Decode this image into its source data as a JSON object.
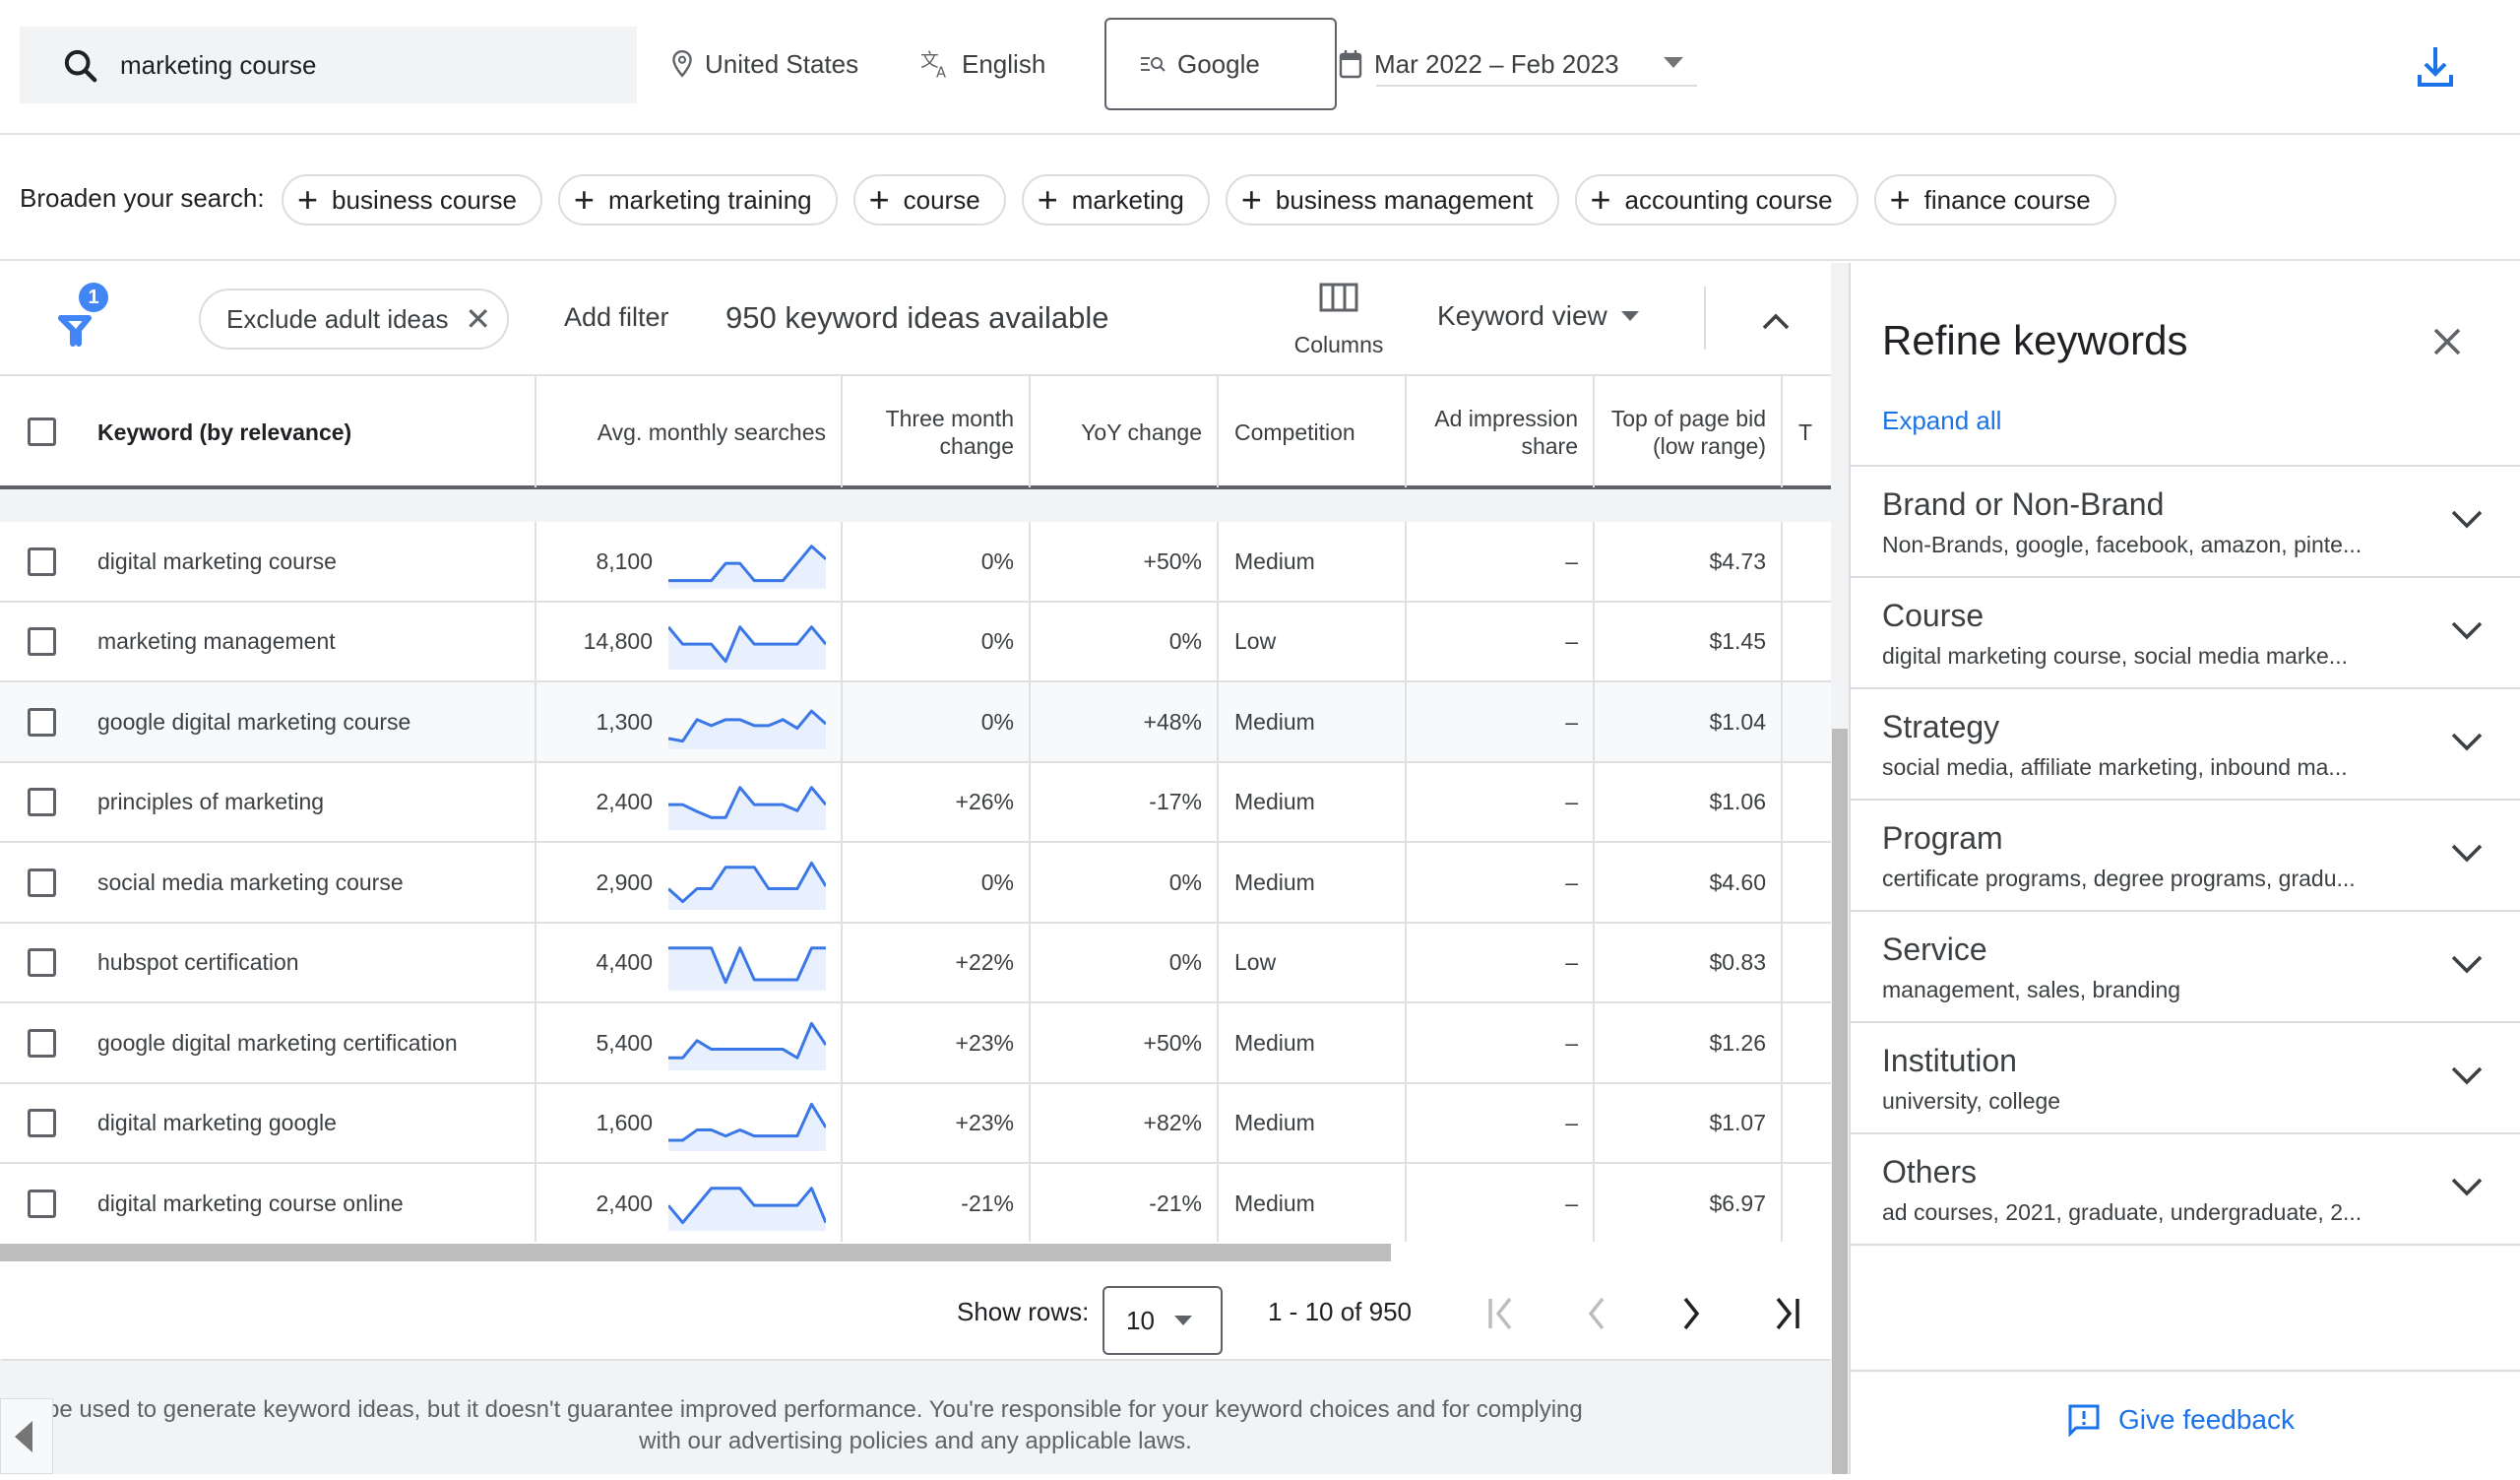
{
  "search": {
    "query": "marketing course",
    "location": "United States",
    "language": "English",
    "network": "Google",
    "date_range": "Mar 2022 – Feb 2023"
  },
  "broaden": {
    "label": "Broaden your search:",
    "chips": [
      "business course",
      "marketing training",
      "course",
      "marketing",
      "business management",
      "accounting course",
      "finance course"
    ]
  },
  "toolbar": {
    "filter_count": "1",
    "exclude_chip": "Exclude adult ideas",
    "add_filter": "Add filter",
    "ideas_count": "950 keyword ideas available",
    "columns_label": "Columns",
    "view_label": "Keyword view"
  },
  "table": {
    "headers": {
      "keyword": "Keyword (by relevance)",
      "avg": "Avg. monthly searches",
      "three_month": "Three month change",
      "yoy": "YoY change",
      "competition": "Competition",
      "ad_share": "Ad impression share",
      "top_low": "Top of page bid (low range)",
      "next": "T"
    },
    "rows": [
      {
        "keyword": "digital marketing course",
        "avg": "8,100",
        "trend": [
          1,
          1,
          1,
          1,
          3,
          3,
          1,
          1,
          1,
          3,
          5,
          3.5
        ],
        "three_month": "0%",
        "yoy": "+50%",
        "competition": "Medium",
        "ad_share": "–",
        "top_low": "$4.73"
      },
      {
        "keyword": "marketing management",
        "avg": "14,800",
        "trend": [
          5,
          3,
          3,
          3,
          1,
          5,
          3,
          3,
          3,
          3,
          5,
          3
        ],
        "three_month": "0%",
        "yoy": "0%",
        "competition": "Low",
        "ad_share": "–",
        "top_low": "$1.45"
      },
      {
        "keyword": "google digital marketing course",
        "avg": "1,300",
        "trend": [
          1.3,
          1,
          3.5,
          2.8,
          3.5,
          3.5,
          2.8,
          2.8,
          3.5,
          2.5,
          4.5,
          3
        ],
        "three_month": "0%",
        "yoy": "+48%",
        "competition": "Medium",
        "ad_share": "–",
        "top_low": "$1.04"
      },
      {
        "keyword": "principles of marketing",
        "avg": "2,400",
        "trend": [
          3,
          3,
          2.2,
          1.5,
          1.5,
          5,
          3,
          3,
          3,
          2.3,
          5,
          3
        ],
        "three_month": "+26%",
        "yoy": "-17%",
        "competition": "Medium",
        "ad_share": "–",
        "top_low": "$1.06"
      },
      {
        "keyword": "social media marketing course",
        "avg": "2,900",
        "trend": [
          2.5,
          1,
          2.5,
          2.5,
          5,
          5,
          5,
          2.5,
          2.5,
          2.5,
          5.5,
          2.8
        ],
        "three_month": "0%",
        "yoy": "0%",
        "competition": "Medium",
        "ad_share": "–",
        "top_low": "$4.60"
      },
      {
        "keyword": "hubspot certification",
        "avg": "4,400",
        "trend": [
          5,
          5,
          5,
          5,
          1,
          5,
          1.3,
          1.3,
          1.3,
          1.3,
          5,
          5
        ],
        "three_month": "+22%",
        "yoy": "0%",
        "competition": "Low",
        "ad_share": "–",
        "top_low": "$0.83"
      },
      {
        "keyword": "google digital marketing certification",
        "avg": "5,400",
        "trend": [
          1.5,
          1.5,
          3.5,
          2.5,
          2.5,
          2.5,
          2.5,
          2.5,
          2.5,
          1.5,
          5.5,
          3
        ],
        "three_month": "+23%",
        "yoy": "+50%",
        "competition": "Medium",
        "ad_share": "–",
        "top_low": "$1.26"
      },
      {
        "keyword": "digital marketing google",
        "avg": "1,600",
        "trend": [
          1.3,
          1.3,
          2.5,
          2.5,
          1.8,
          2.5,
          1.8,
          1.8,
          1.8,
          1.8,
          5.5,
          2.8
        ],
        "three_month": "+23%",
        "yoy": "+82%",
        "competition": "Medium",
        "ad_share": "–",
        "top_low": "$1.07"
      },
      {
        "keyword": "digital marketing course online",
        "avg": "2,400",
        "trend": [
          3,
          1,
          3,
          5,
          5,
          5,
          3,
          3,
          3,
          3,
          5,
          1
        ],
        "three_month": "-21%",
        "yoy": "-21%",
        "competition": "Medium",
        "ad_share": "–",
        "top_low": "$6.97"
      }
    ]
  },
  "pagination": {
    "show_rows_label": "Show rows:",
    "rows_per_page": "10",
    "range": "1 - 10 of 950"
  },
  "disclaimer": {
    "line1": "Keyword Planner can be used to generate keyword ideas, but it doesn't guarantee improved performance. You're responsible for your keyword choices and for complying",
    "line2": "with our advertising policies and any applicable laws."
  },
  "refine": {
    "title": "Refine keywords",
    "expand_all": "Expand all",
    "groups": [
      {
        "name": "Brand or Non-Brand",
        "summary": "Non-Brands, google, facebook, amazon, pinte..."
      },
      {
        "name": "Course",
        "summary": "digital marketing course, social media marke..."
      },
      {
        "name": "Strategy",
        "summary": "social media, affiliate marketing, inbound ma..."
      },
      {
        "name": "Program",
        "summary": "certificate programs, degree programs, gradu..."
      },
      {
        "name": "Service",
        "summary": "management, sales, branding"
      },
      {
        "name": "Institution",
        "summary": "university, college"
      },
      {
        "name": "Others",
        "summary": "ad courses, 2021, graduate, undergraduate, 2..."
      }
    ],
    "feedback": "Give feedback"
  },
  "colors": {
    "accent": "#1a73e8",
    "sparkline": "#3b78e7",
    "sparkline_fill": "#e8f0fe"
  }
}
